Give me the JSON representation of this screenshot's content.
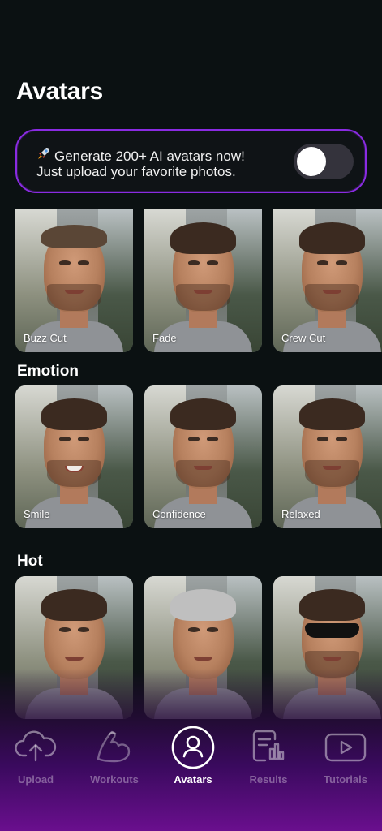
{
  "page": {
    "title": "Avatars"
  },
  "promo": {
    "icon": "rocket-icon",
    "line1": "Generate 200+ AI avatars now!",
    "line2": "Just upload your favorite photos.",
    "toggle_on": false
  },
  "sections": [
    {
      "title": "",
      "items": [
        {
          "label": "Buzz Cut"
        },
        {
          "label": "Fade"
        },
        {
          "label": "Crew Cut"
        }
      ]
    },
    {
      "title": "Emotion",
      "items": [
        {
          "label": "Smile"
        },
        {
          "label": "Confidence"
        },
        {
          "label": "Relaxed"
        }
      ]
    },
    {
      "title": "Hot",
      "items": [
        {
          "label": ""
        },
        {
          "label": ""
        },
        {
          "label": ""
        }
      ]
    }
  ],
  "nav": {
    "items": [
      {
        "label": "Upload",
        "icon": "cloud-upload-icon"
      },
      {
        "label": "Workouts",
        "icon": "flexed-arm-icon"
      },
      {
        "label": "Avatars",
        "icon": "user-circle-icon",
        "active": true
      },
      {
        "label": "Results",
        "icon": "chart-document-icon"
      },
      {
        "label": "Tutorials",
        "icon": "play-button-icon"
      }
    ]
  },
  "colors": {
    "accent": "#8a2be2",
    "background": "#0b1112",
    "nav_gradient_end": "#6a0f8e"
  }
}
